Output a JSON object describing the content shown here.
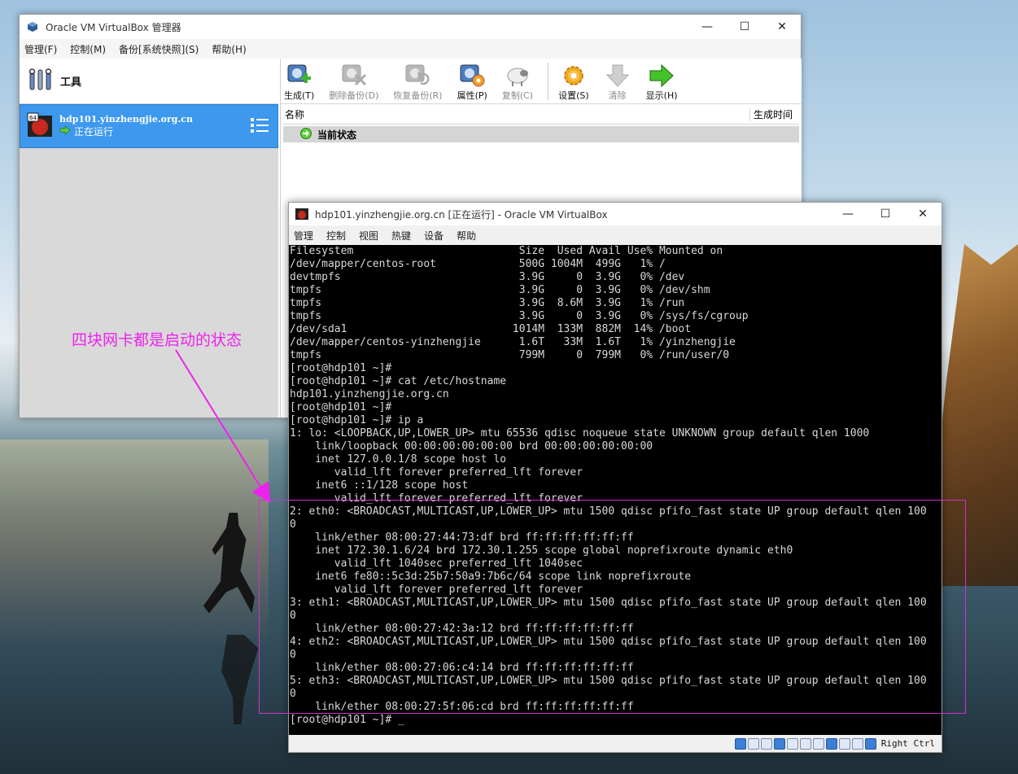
{
  "manager": {
    "title": "Oracle VM VirtualBox 管理器",
    "menu": [
      "管理(F)",
      "控制(M)",
      "备份[系统快照](S)",
      "帮助(H)"
    ],
    "tools_label": "工具",
    "vm": {
      "name": "hdp101.yinzhengjie.org.cn",
      "state": "正在运行",
      "badge": "64"
    },
    "toolbar": {
      "take": "生成(T)",
      "delete": "删除备份(D)",
      "restore": "恢复备份(R)",
      "properties": "属性(P)",
      "clone": "复制(C)",
      "settings": "设置(S)",
      "discard": "清除",
      "show": "显示(H)"
    },
    "snapshot_table": {
      "col_name": "名称",
      "col_time": "生成时间",
      "current_state": "当前状态"
    }
  },
  "vm_window": {
    "title": "hdp101.yinzhengjie.org.cn [正在运行] - Oracle VM VirtualBox",
    "menu": [
      "管理",
      "控制",
      "视图",
      "热键",
      "设备",
      "帮助"
    ],
    "host_key": "Right Ctrl",
    "console_lines": [
      "Filesystem                          Size  Used Avail Use% Mounted on",
      "/dev/mapper/centos-root             500G 1004M  499G   1% /",
      "devtmpfs                            3.9G     0  3.9G   0% /dev",
      "tmpfs                               3.9G     0  3.9G   0% /dev/shm",
      "tmpfs                               3.9G  8.6M  3.9G   1% /run",
      "tmpfs                               3.9G     0  3.9G   0% /sys/fs/cgroup",
      "/dev/sda1                          1014M  133M  882M  14% /boot",
      "/dev/mapper/centos-yinzhengjie      1.6T   33M  1.6T   1% /yinzhengjie",
      "tmpfs                               799M     0  799M   0% /run/user/0",
      "[root@hdp101 ~]#",
      "[root@hdp101 ~]# cat /etc/hostname",
      "hdp101.yinzhengjie.org.cn",
      "[root@hdp101 ~]#",
      "[root@hdp101 ~]# ip a",
      "1: lo: <LOOPBACK,UP,LOWER_UP> mtu 65536 qdisc noqueue state UNKNOWN group default qlen 1000",
      "    link/loopback 00:00:00:00:00:00 brd 00:00:00:00:00:00",
      "    inet 127.0.0.1/8 scope host lo",
      "       valid_lft forever preferred_lft forever",
      "    inet6 ::1/128 scope host",
      "       valid_lft forever preferred_lft forever",
      "2: eth0: <BROADCAST,MULTICAST,UP,LOWER_UP> mtu 1500 qdisc pfifo_fast state UP group default qlen 100",
      "0",
      "    link/ether 08:00:27:44:73:df brd ff:ff:ff:ff:ff:ff",
      "    inet 172.30.1.6/24 brd 172.30.1.255 scope global noprefixroute dynamic eth0",
      "       valid_lft 1040sec preferred_lft 1040sec",
      "    inet6 fe80::5c3d:25b7:50a9:7b6c/64 scope link noprefixroute",
      "       valid_lft forever preferred_lft forever",
      "3: eth1: <BROADCAST,MULTICAST,UP,LOWER_UP> mtu 1500 qdisc pfifo_fast state UP group default qlen 100",
      "0",
      "    link/ether 08:00:27:42:3a:12 brd ff:ff:ff:ff:ff:ff",
      "4: eth2: <BROADCAST,MULTICAST,UP,LOWER_UP> mtu 1500 qdisc pfifo_fast state UP group default qlen 100",
      "0",
      "    link/ether 08:00:27:06:c4:14 brd ff:ff:ff:ff:ff:ff",
      "5: eth3: <BROADCAST,MULTICAST,UP,LOWER_UP> mtu 1500 qdisc pfifo_fast state UP group default qlen 100",
      "0",
      "    link/ether 08:00:27:5f:06:cd brd ff:ff:ff:ff:ff:ff",
      "[root@hdp101 ~]# _"
    ]
  },
  "annotation": {
    "text": "四块网卡都是启动的状态",
    "color": "#ee22ee"
  }
}
